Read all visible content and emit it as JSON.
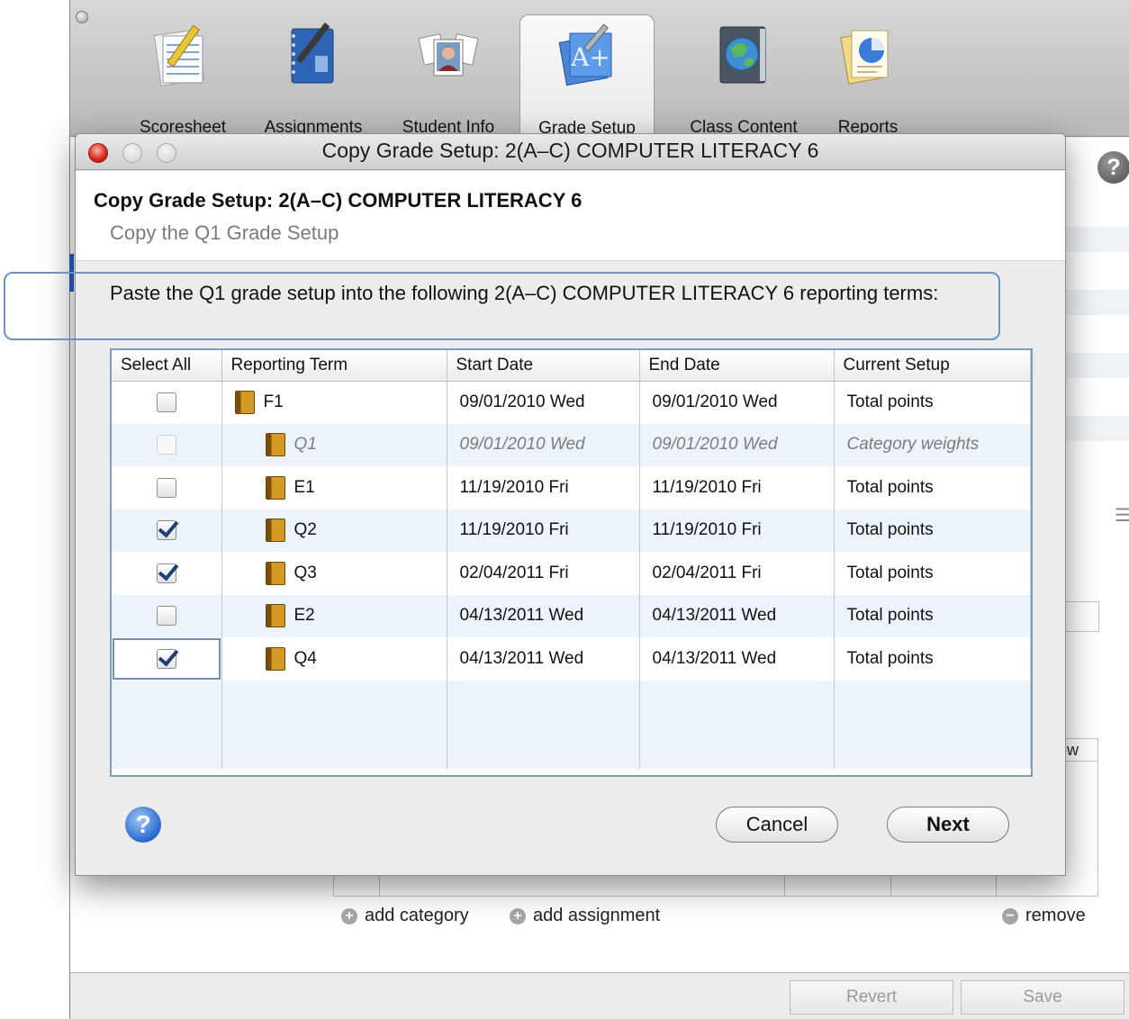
{
  "toolbar": {
    "items": [
      {
        "label": "Scoresheet",
        "icon": "scoresheet-icon"
      },
      {
        "label": "Assignments",
        "icon": "assignments-icon"
      },
      {
        "label": "Student Info",
        "icon": "student-info-icon"
      },
      {
        "label": "Grade Setup",
        "icon": "grade-setup-icon",
        "active": true
      },
      {
        "label": "Class Content",
        "icon": "class-content-icon"
      },
      {
        "label": "Reports",
        "icon": "reports-icon"
      }
    ]
  },
  "background": {
    "help_label": "?",
    "column_header_fragment": "ow",
    "actions": {
      "add_category": "add category",
      "add_assignment": "add assignment",
      "remove": "remove"
    },
    "buttons": {
      "revert": "Revert",
      "save": "Save"
    }
  },
  "dialog": {
    "window_title": "Copy Grade Setup: 2(A–C) COMPUTER LITERACY 6",
    "header_title": "Copy Grade Setup: 2(A–C) COMPUTER LITERACY 6",
    "header_subtitle": "Copy the Q1 Grade Setup",
    "instruction": "Paste the Q1 grade setup into the following 2(A–C) COMPUTER LITERACY 6 reporting terms:",
    "table": {
      "columns": [
        "Select All",
        "Reporting Term",
        "Start Date",
        "End Date",
        "Current Setup"
      ],
      "rows": [
        {
          "checked": false,
          "disabled": false,
          "term": "F1",
          "indent": false,
          "start": "09/01/2010 Wed",
          "end": "09/01/2010 Wed",
          "setup": "Total points"
        },
        {
          "checked": false,
          "disabled": true,
          "term": "Q1",
          "indent": true,
          "start": "09/01/2010 Wed",
          "end": "09/01/2010 Wed",
          "setup": "Category weights"
        },
        {
          "checked": false,
          "disabled": false,
          "term": "E1",
          "indent": true,
          "start": "11/19/2010 Fri",
          "end": "11/19/2010 Fri",
          "setup": "Total points"
        },
        {
          "checked": true,
          "disabled": false,
          "term": "Q2",
          "indent": true,
          "start": "11/19/2010 Fri",
          "end": "11/19/2010 Fri",
          "setup": "Total points"
        },
        {
          "checked": true,
          "disabled": false,
          "term": "Q3",
          "indent": true,
          "start": "02/04/2011 Fri",
          "end": "02/04/2011 Fri",
          "setup": "Total points"
        },
        {
          "checked": false,
          "disabled": false,
          "term": "E2",
          "indent": true,
          "start": "04/13/2011 Wed",
          "end": "04/13/2011 Wed",
          "setup": "Total points"
        },
        {
          "checked": true,
          "disabled": false,
          "term": "Q4",
          "indent": true,
          "start": "04/13/2011 Wed",
          "end": "04/13/2011 Wed",
          "setup": "Total points",
          "focused": true
        }
      ]
    },
    "help_label": "?",
    "buttons": {
      "cancel": "Cancel",
      "next": "Next"
    }
  },
  "colors": {
    "accent_blue": "#2e6fd0",
    "highlight_border": "#6c93c2",
    "row_stripe": "#edf3fa",
    "close_red": "#d6241a"
  }
}
